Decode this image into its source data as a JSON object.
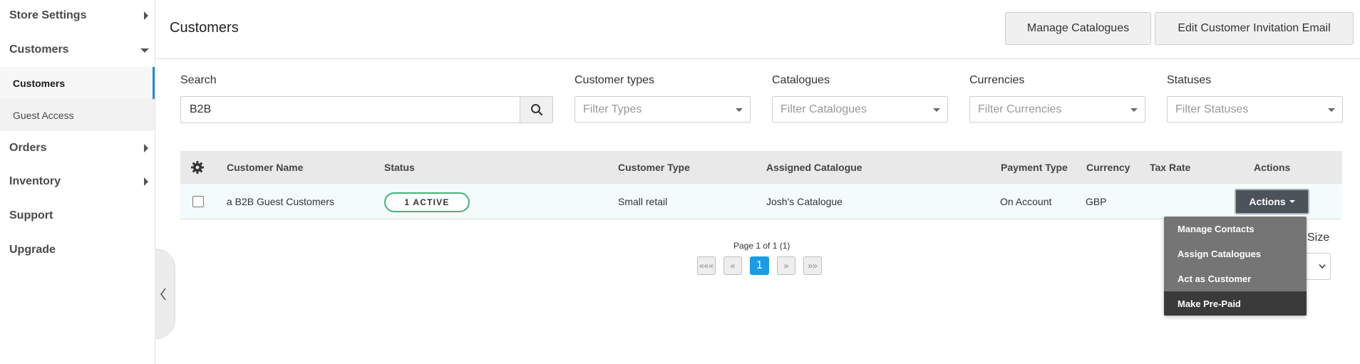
{
  "sidebar": {
    "items": [
      {
        "label": "Store Settings"
      },
      {
        "label": "Customers"
      },
      {
        "label": "Orders"
      },
      {
        "label": "Inventory"
      },
      {
        "label": "Support"
      },
      {
        "label": "Upgrade"
      }
    ],
    "customers_sub": [
      {
        "label": "Customers"
      },
      {
        "label": "Guest Access"
      }
    ],
    "collapse_icon": "chevron-left-icon"
  },
  "header": {
    "title": "Customers",
    "manage_catalogues": "Manage Catalogues",
    "edit_invitation_email": "Edit Customer Invitation Email"
  },
  "filters": {
    "search_label": "Search",
    "search_value": "B2B",
    "search_icon": "search-icon",
    "customer_types": {
      "label": "Customer types",
      "placeholder": "Filter Types"
    },
    "catalogues": {
      "label": "Catalogues",
      "placeholder": "Filter Catalogues"
    },
    "currencies": {
      "label": "Currencies",
      "placeholder": "Filter Currencies"
    },
    "statuses": {
      "label": "Statuses",
      "placeholder": "Filter Statuses"
    }
  },
  "table": {
    "settings_icon": "gear-icon",
    "columns": [
      "Customer Name",
      "Status",
      "Customer Type",
      "Assigned Catalogue",
      "Payment Type",
      "Currency",
      "Tax Rate",
      "Actions"
    ],
    "rows": [
      {
        "name": "a B2B Guest Customers",
        "status": "1 ACTIVE",
        "customer_type": "Small retail",
        "assigned_catalogue": "Josh's Catalogue",
        "payment_type": "On Account",
        "currency": "GBP",
        "tax_rate": "",
        "actions_label": "Actions"
      }
    ]
  },
  "actions_menu": {
    "items": [
      "Manage Contacts",
      "Assign Catalogues",
      "Act as Customer",
      "Make Pre-Paid"
    ],
    "highlighted": "Make Pre-Paid"
  },
  "pagination": {
    "info": "Page 1 of 1 (1)",
    "first": "«««",
    "prev": "«",
    "current": "1",
    "next": "»",
    "last": "»»",
    "page_size_label": "Size"
  },
  "colors": {
    "accent": "#1a9be6",
    "active_badge": "#3cb878",
    "actions_button": "#4a525a",
    "dropdown_bg": "#757575",
    "dropdown_hover": "#3a3a3a"
  }
}
